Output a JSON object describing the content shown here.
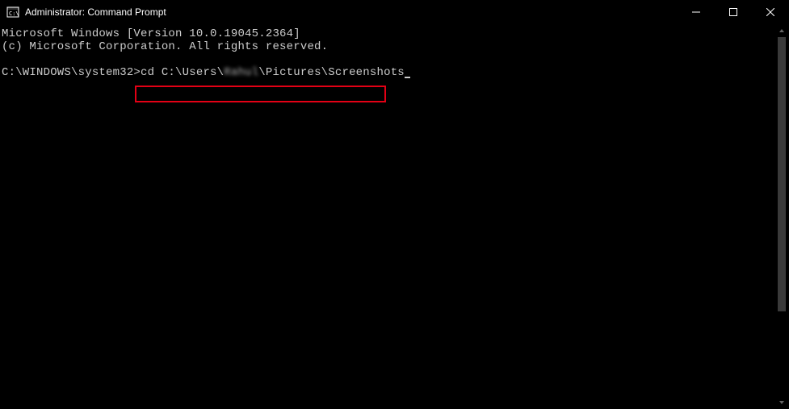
{
  "titlebar": {
    "title": "Administrator: Command Prompt"
  },
  "terminal": {
    "line1": "Microsoft Windows [Version 10.0.19045.2364]",
    "line2": "(c) Microsoft Corporation. All rights reserved.",
    "prompt": "C:\\WINDOWS\\system32>",
    "cmd_prefix": "cd C:\\Users\\",
    "cmd_user": "Rahul",
    "cmd_suffix": "\\Pictures\\Screenshots"
  }
}
